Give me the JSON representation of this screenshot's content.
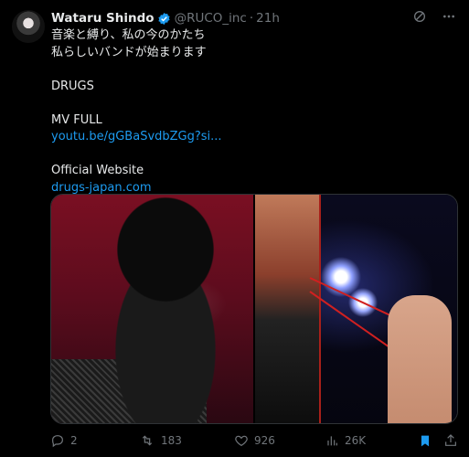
{
  "tweet": {
    "author_name": "Wataru Shindo",
    "handle": "@RUCO_inc",
    "separator": "·",
    "time": "21h",
    "lines": [
      "音楽と縛り、私の今のかたち",
      "私らしいバンドが始まります",
      "",
      "DRUGS",
      "",
      "MV FULL",
      "youtu.be/gGBaSvdbZGg?si...",
      "",
      "Official Website",
      "drugs-japan.com"
    ],
    "links": {
      "mv": "youtu.be/gGBaSvdbZGg?si...",
      "website": "drugs-japan.com"
    }
  },
  "actions": {
    "replies": "2",
    "retweets": "183",
    "likes": "926",
    "views": "26K"
  },
  "colors": {
    "link": "#1d9bf0",
    "muted": "#71767b",
    "text": "#e7e9ea",
    "bookmark": "#1d9bf0"
  },
  "icons": {
    "top_right": [
      "grok-icon",
      "more-icon"
    ],
    "actions": [
      "reply-icon",
      "retweet-icon",
      "like-icon",
      "views-icon",
      "bookmark-icon",
      "share-icon"
    ]
  }
}
